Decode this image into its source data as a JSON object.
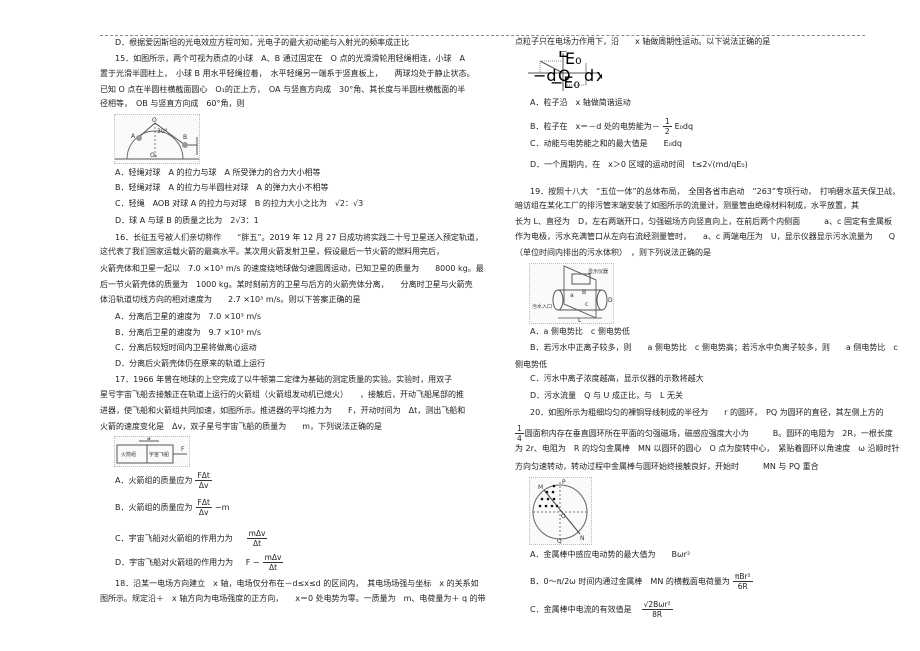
{
  "q14": {
    "option_d": "D．根据爱因斯坦的光电效应方程可知，光电子的最大初动能与入射光的频率成正比"
  },
  "q15": {
    "stem": [
      "15．如图所示，两个可视为质点的小球　A、B 通过固定在　O 点的光滑滑轮用轻绳相连，小球　A",
      "置于光滑半圆柱上，　小球 B 用水平轻绳拉着，　水平轻绳另一端系于竖直板上，　　两球均处于静止状态。",
      "已知 O 点在半圆柱横截面圆心　O₁的正上方，　OA 与竖直方向成　30°角、其长度与半圆柱横截面的半",
      "径相等，　OB 与竖直方向成　60°角，则"
    ],
    "figure_labels": {
      "o": "O",
      "a": "A",
      "b": "B",
      "o1": "O₁",
      "angle": "30°"
    },
    "options": [
      "A．轻绳对球　A 的拉力与球　A 所受弹力的合力大小相等",
      "B．轻绳对球　A 的拉力与半圆柱对球　A 的弹力大小不相等",
      "C．轻绳　AOB 对球 A 的拉力与对球　B 的拉力大小之比为　√2：√3",
      "D．球 A 与球 B 的质量之比为　2√3：1"
    ]
  },
  "q16": {
    "stem": [
      "16．长征五号被人们亲切称作　　“胖五”。2019 年 12 月 27 日成功将实践二十号卫星送入预定轨道，",
      "这代表了我们国家运载火箭的最高水平。某次用火箭发射卫星，假设最后一节火箭的燃料用完后，",
      "火箭壳体和卫星一起以　7.0 ×10³ m/s 的速度绕地球做匀速圆周运动，已知卫星的质量为　　8000 kg。最",
      "后一节火箭壳体的质量为　1000 kg。某时刻前方的卫星与后方的火箭壳体分离，　　分离时卫星与火箭壳",
      "体沿轨道切线方向的相对速度为　　2.7 ×10³ m/s。则以下答案正确的是"
    ],
    "options": [
      "A．分离后卫星的速度为　7.0 ×10³ m/s",
      "B．分离后卫星的速度为　9.7 ×10³ m/s",
      "C．分离后较短时间内卫星将做离心运动",
      "D．分离后火箭壳体仍在原来的轨道上运行"
    ]
  },
  "q17": {
    "stem": [
      "17．1966 年曾在地球的上空完成了以牛顿第二定律为基础的测定质量的实验。实验时，用双子",
      "星号宇宙飞船去接触正在轨道上运行的火箭组（火箭组发动机已熄火）　　，接触后，开动飞船尾部的推",
      "进器，使飞船和火箭组共同加速，如图所示。推进器的平均推力为　　F，开动时间为　Δt，测出飞船和",
      "火箭的速度变化是　Δv，双子星号宇宙飞船的质量为　　m，下列说法正确的是"
    ],
    "figure_labels": {
      "rocket": "火箭组",
      "ship": "宇宙飞船",
      "force": "F",
      "accel": "a"
    },
    "options": {
      "a": {
        "text": "A．火箭组的质量应为",
        "num": "FΔt",
        "den": "Δv"
      },
      "b": {
        "text": "B．火箭组的质量应为",
        "num": "FΔt",
        "den": "Δv",
        "suffix": "−m"
      },
      "c": {
        "text": "C．宇宙飞船对火箭组的作用力为",
        "num": "mΔv",
        "den": "Δt"
      },
      "d": {
        "text": "D．宇宙飞船对火箭组的作用力为",
        "prefix": "F −",
        "num": "mΔv",
        "den": "Δt"
      }
    }
  },
  "q18": {
    "stem": [
      "18．沿某一电场方向建立　x 轴，电场仅分布在－d≤x≤d 的区间内，　其电场场强与坐标　x 的关系如",
      "图所示。规定沿＋　x 轴方向为电场强度的正方向，　　x＝0 处电势为零。一质量为　m、电荷量为＋ q 的带",
      "点粒子只在电场力作用下，沿　　x 轴做周期性运动。以下说法正确的是"
    ],
    "figure_labels": {
      "e": "E",
      "e0": "E₀",
      "neg_d": "−d",
      "o": "O",
      "d": "d",
      "x": "x",
      "neg_e0": "−E₀"
    },
    "options": {
      "a": "A．粒子沿　x 轴做简谐运动",
      "b": {
        "text": "B．粒子在　x＝－d 处的电势能为－",
        "num": "1",
        "den": "2",
        "suffix": "E₀dq"
      },
      "c": "C．动能与电势能之和的最大值是　　E₀dq",
      "d": "D．一个周期内，在　x＞0 区域的运动时间　t≤2√(md/qE₀)"
    }
  },
  "q19": {
    "stem": [
      "19．按照十八大　“五位一体”的总体布局，　全国各省市启动　“263”专项行动，　打响碧水蓝天保卫战，",
      "暗访组在某化工厂的排污管末端安装了如图所示的流量计，测量管由绝缘材料制成，水平放置，其",
      "长为 L、直径为　D，左右两端开口，匀强磁场方向竖直向上，在前后两个内侧面　　　a、c 固定有金属板",
      "作为电极，污水充满管口从左向右流经测量管时，　　a、c 两端电压为　U，显示仪器显示污水流量为　　Q",
      "（单位时间内排出的污水体积）　，则下列说法正确的是"
    ],
    "figure_labels": {
      "display": "显示仪器",
      "inlet": "污水入口",
      "d": "D",
      "l": "L",
      "a": "a",
      "c": "c",
      "b": "B"
    },
    "options": [
      "A．a 侧电势比　c 侧电势低",
      "B．若污水中正离子较多，则　　a 侧电势比　c 侧电势高；若污水中负离子较多，则　　a 侧电势比　c",
      "侧电势低",
      "C．污水中离子浓度越高，显示仪器的示数将越大",
      "D．污水流量　Q 与 U 成正比，与　L 无关"
    ]
  },
  "q20": {
    "stem": [
      "20．如图所示为粗细均匀的裸铜导线制成的半径为　　r 的圆环，　PQ 为圆环的直径，其左侧上方的",
      "圆面积内存在垂直圆环所在平面的匀强磁场，磁感应强度大小为　　　B。圆环的电阻为　2R，一根长度",
      "为 2r、电阻为　R 的均匀金属棒　MN 以圆环的圆心　O 点为旋转中心，　紧贴着圆环以角速度　ω 沿顺时针",
      "方向匀速转动，转动过程中金属棒与圆环始终接触良好，开始时　　　MN 与 PQ 重合"
    ],
    "quarter": {
      "num": "1",
      "den": "4"
    },
    "figure_labels": {
      "p": "P",
      "q": "Q",
      "m": "M",
      "n": "N",
      "o": "O"
    },
    "options": {
      "a": "A．金属棒中感应电动势的最大值为　　Bωr²",
      "b": {
        "text": "B．0～π/2ω 时间内通过金属棒　MN 的横截面电荷量为",
        "num": "πBr²",
        "den": "6R"
      },
      "c": {
        "text": "C．金属棒中电流的有效值是",
        "num": "√2Bωr²",
        "den": "8R"
      }
    }
  }
}
